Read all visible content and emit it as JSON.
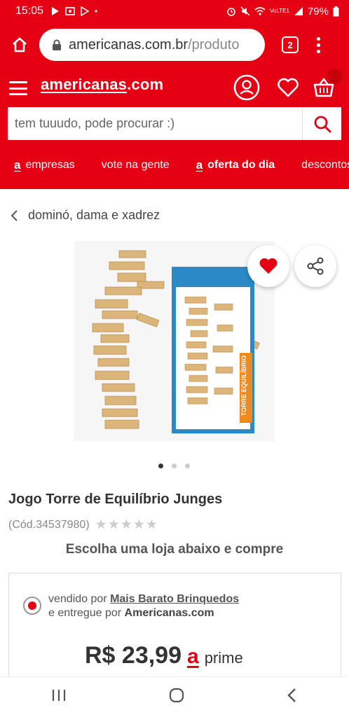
{
  "status": {
    "time": "15:05",
    "network": "VoLTE1",
    "battery": "79%"
  },
  "browser": {
    "url_host": "americanas.com.br",
    "url_path": "/produto",
    "tab_count": "2"
  },
  "site": {
    "logo_brand": "americanas",
    "logo_suffix": ".com",
    "search_placeholder": "tem tuuudo, pode procurar :)",
    "nav": [
      {
        "mark": "a",
        "label": "empresas"
      },
      {
        "mark": "",
        "label": "vote na gente"
      },
      {
        "mark": "a",
        "label": "oferta do dia"
      },
      {
        "mark": "",
        "label": "descontos"
      }
    ]
  },
  "breadcrumb": {
    "label": "dominó, dama e xadrez"
  },
  "product": {
    "box_text": "TORRE EQUILÍBRIO",
    "title": "Jogo Torre de Equilíbrio Junges",
    "code": "(Cód.34537980)",
    "rating_stars": 0,
    "rating_max": 5,
    "carousel_total": 3,
    "carousel_index": 0
  },
  "offer": {
    "choose_text": "Escolha uma loja abaixo e compre",
    "sold_by_label": "vendido por",
    "seller": "Mais Barato Brinquedos",
    "delivered_by_label": "e entregue por",
    "delivered_by": "Americanas.com",
    "price": "R$ 23,99",
    "prime_mark": "a",
    "prime_label": "prime"
  },
  "colors": {
    "brand_red": "#e60014"
  }
}
